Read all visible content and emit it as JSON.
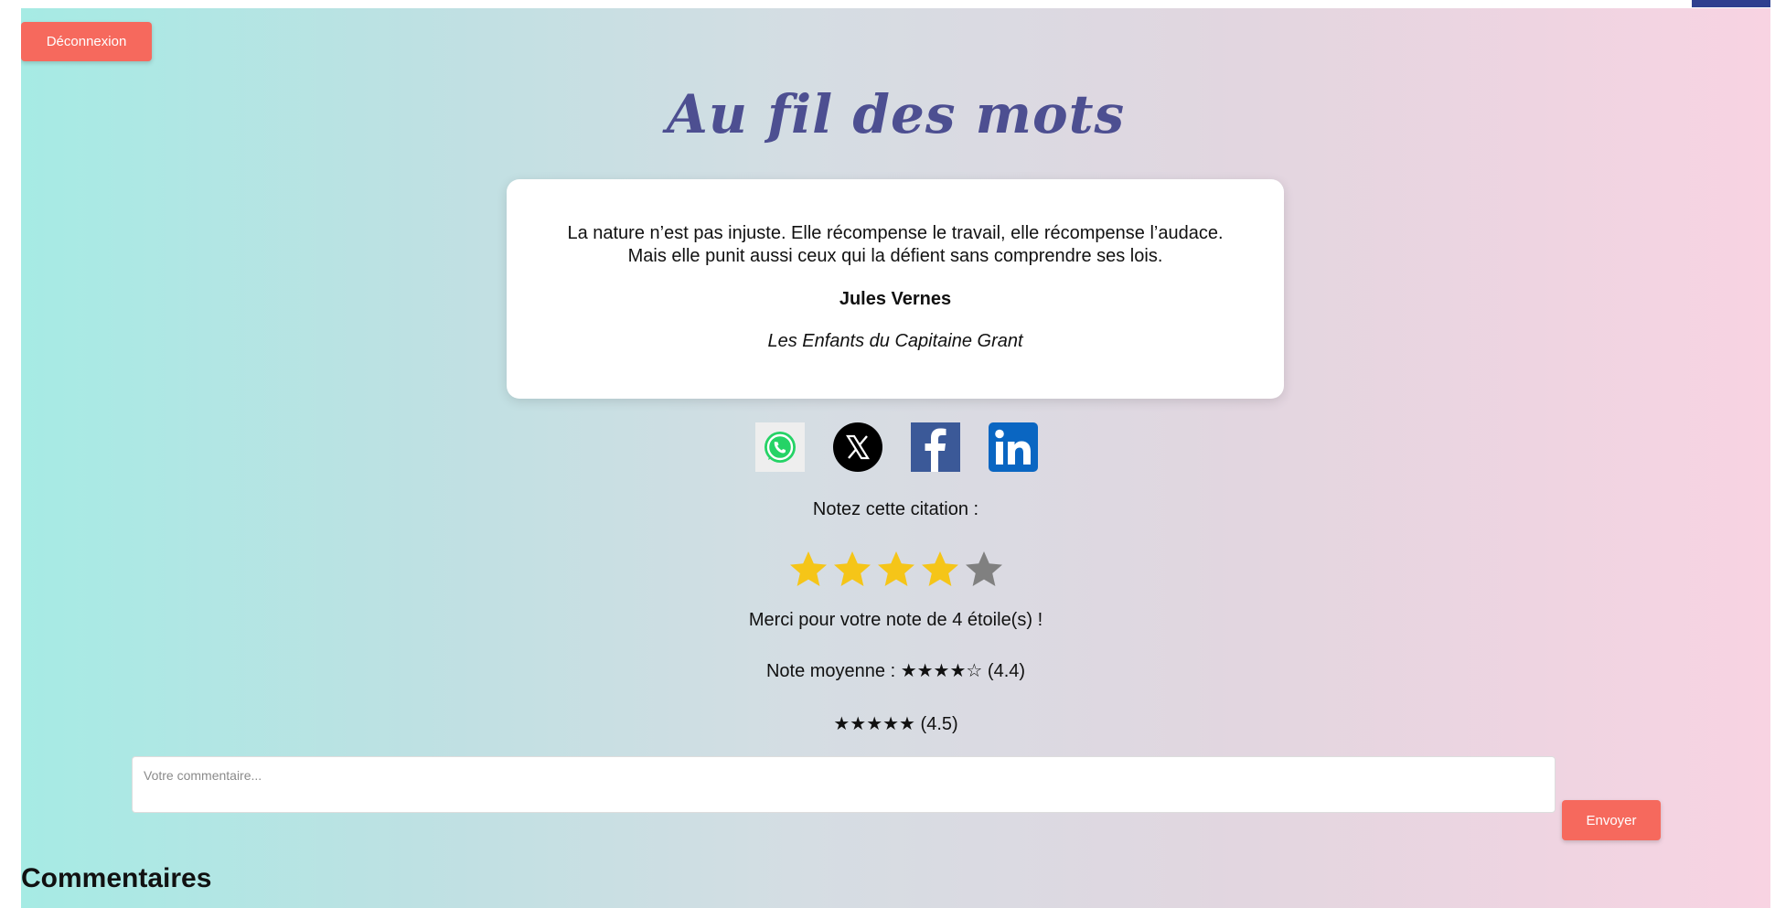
{
  "header": {
    "logout_label": "Déconnexion",
    "site_title": "Au fil des mots"
  },
  "quote": {
    "line1": "La nature n’est pas injuste. Elle récompense le travail, elle récompense l’audace.",
    "line2": "Mais elle punit aussi ceux qui la défient sans comprendre ses lois.",
    "author": "Jules Vernes",
    "book": "Les Enfants du Capitaine Grant"
  },
  "share": {
    "icons": [
      "whatsapp-icon",
      "x-icon",
      "facebook-icon",
      "linkedin-icon"
    ],
    "colors": {
      "whatsapp": "#25d366",
      "x": "#000000",
      "facebook": "#3b5998",
      "linkedin": "#0a66c2"
    }
  },
  "rating": {
    "label": "Notez cette citation :",
    "selected": 4,
    "max": 5,
    "active_color": "#f5c518",
    "inactive_color": "#808080",
    "thanks": "Merci pour votre note de 4 étoile(s) !",
    "average_text": "Note moyenne : ★★★★☆ (4.4)",
    "secondary_text": "★★★★★ (4.5)"
  },
  "comment": {
    "placeholder": "Votre commentaire...",
    "send_label": "Envoyer",
    "heading": "Commentaires"
  },
  "theme": {
    "button_color": "#f6695d",
    "title_color": "#4d4f91"
  }
}
